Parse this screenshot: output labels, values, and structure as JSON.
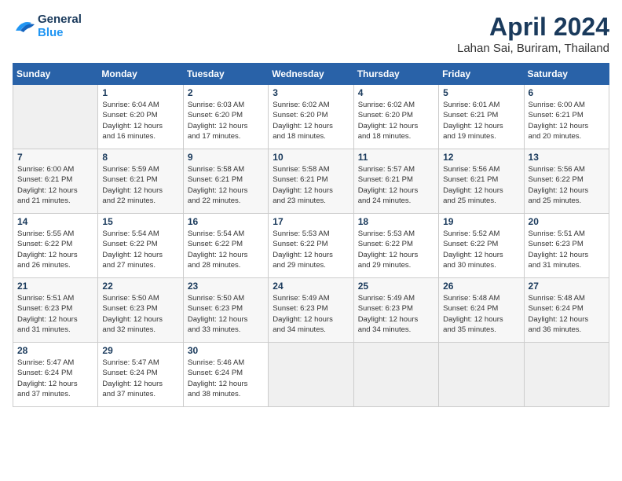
{
  "header": {
    "logo_line1": "General",
    "logo_line2": "Blue",
    "month": "April 2024",
    "location": "Lahan Sai, Buriram, Thailand"
  },
  "weekdays": [
    "Sunday",
    "Monday",
    "Tuesday",
    "Wednesday",
    "Thursday",
    "Friday",
    "Saturday"
  ],
  "weeks": [
    [
      {
        "day": "",
        "info": ""
      },
      {
        "day": "1",
        "info": "Sunrise: 6:04 AM\nSunset: 6:20 PM\nDaylight: 12 hours\nand 16 minutes."
      },
      {
        "day": "2",
        "info": "Sunrise: 6:03 AM\nSunset: 6:20 PM\nDaylight: 12 hours\nand 17 minutes."
      },
      {
        "day": "3",
        "info": "Sunrise: 6:02 AM\nSunset: 6:20 PM\nDaylight: 12 hours\nand 18 minutes."
      },
      {
        "day": "4",
        "info": "Sunrise: 6:02 AM\nSunset: 6:20 PM\nDaylight: 12 hours\nand 18 minutes."
      },
      {
        "day": "5",
        "info": "Sunrise: 6:01 AM\nSunset: 6:21 PM\nDaylight: 12 hours\nand 19 minutes."
      },
      {
        "day": "6",
        "info": "Sunrise: 6:00 AM\nSunset: 6:21 PM\nDaylight: 12 hours\nand 20 minutes."
      }
    ],
    [
      {
        "day": "7",
        "info": "Sunrise: 6:00 AM\nSunset: 6:21 PM\nDaylight: 12 hours\nand 21 minutes."
      },
      {
        "day": "8",
        "info": "Sunrise: 5:59 AM\nSunset: 6:21 PM\nDaylight: 12 hours\nand 22 minutes."
      },
      {
        "day": "9",
        "info": "Sunrise: 5:58 AM\nSunset: 6:21 PM\nDaylight: 12 hours\nand 22 minutes."
      },
      {
        "day": "10",
        "info": "Sunrise: 5:58 AM\nSunset: 6:21 PM\nDaylight: 12 hours\nand 23 minutes."
      },
      {
        "day": "11",
        "info": "Sunrise: 5:57 AM\nSunset: 6:21 PM\nDaylight: 12 hours\nand 24 minutes."
      },
      {
        "day": "12",
        "info": "Sunrise: 5:56 AM\nSunset: 6:21 PM\nDaylight: 12 hours\nand 25 minutes."
      },
      {
        "day": "13",
        "info": "Sunrise: 5:56 AM\nSunset: 6:22 PM\nDaylight: 12 hours\nand 25 minutes."
      }
    ],
    [
      {
        "day": "14",
        "info": "Sunrise: 5:55 AM\nSunset: 6:22 PM\nDaylight: 12 hours\nand 26 minutes."
      },
      {
        "day": "15",
        "info": "Sunrise: 5:54 AM\nSunset: 6:22 PM\nDaylight: 12 hours\nand 27 minutes."
      },
      {
        "day": "16",
        "info": "Sunrise: 5:54 AM\nSunset: 6:22 PM\nDaylight: 12 hours\nand 28 minutes."
      },
      {
        "day": "17",
        "info": "Sunrise: 5:53 AM\nSunset: 6:22 PM\nDaylight: 12 hours\nand 29 minutes."
      },
      {
        "day": "18",
        "info": "Sunrise: 5:53 AM\nSunset: 6:22 PM\nDaylight: 12 hours\nand 29 minutes."
      },
      {
        "day": "19",
        "info": "Sunrise: 5:52 AM\nSunset: 6:22 PM\nDaylight: 12 hours\nand 30 minutes."
      },
      {
        "day": "20",
        "info": "Sunrise: 5:51 AM\nSunset: 6:23 PM\nDaylight: 12 hours\nand 31 minutes."
      }
    ],
    [
      {
        "day": "21",
        "info": "Sunrise: 5:51 AM\nSunset: 6:23 PM\nDaylight: 12 hours\nand 31 minutes."
      },
      {
        "day": "22",
        "info": "Sunrise: 5:50 AM\nSunset: 6:23 PM\nDaylight: 12 hours\nand 32 minutes."
      },
      {
        "day": "23",
        "info": "Sunrise: 5:50 AM\nSunset: 6:23 PM\nDaylight: 12 hours\nand 33 minutes."
      },
      {
        "day": "24",
        "info": "Sunrise: 5:49 AM\nSunset: 6:23 PM\nDaylight: 12 hours\nand 34 minutes."
      },
      {
        "day": "25",
        "info": "Sunrise: 5:49 AM\nSunset: 6:23 PM\nDaylight: 12 hours\nand 34 minutes."
      },
      {
        "day": "26",
        "info": "Sunrise: 5:48 AM\nSunset: 6:24 PM\nDaylight: 12 hours\nand 35 minutes."
      },
      {
        "day": "27",
        "info": "Sunrise: 5:48 AM\nSunset: 6:24 PM\nDaylight: 12 hours\nand 36 minutes."
      }
    ],
    [
      {
        "day": "28",
        "info": "Sunrise: 5:47 AM\nSunset: 6:24 PM\nDaylight: 12 hours\nand 37 minutes."
      },
      {
        "day": "29",
        "info": "Sunrise: 5:47 AM\nSunset: 6:24 PM\nDaylight: 12 hours\nand 37 minutes."
      },
      {
        "day": "30",
        "info": "Sunrise: 5:46 AM\nSunset: 6:24 PM\nDaylight: 12 hours\nand 38 minutes."
      },
      {
        "day": "",
        "info": ""
      },
      {
        "day": "",
        "info": ""
      },
      {
        "day": "",
        "info": ""
      },
      {
        "day": "",
        "info": ""
      }
    ]
  ]
}
